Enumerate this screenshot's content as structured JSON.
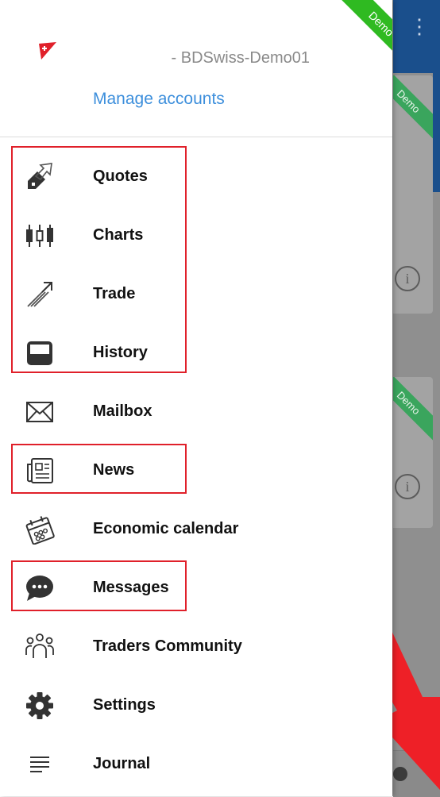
{
  "app": {
    "demo_badge": "Demo",
    "brand_color": "#e0202a",
    "accent": "#3d8fdc"
  },
  "account": {
    "name": "- BDSwiss-Demo01",
    "manage_label": "Manage accounts"
  },
  "menu": [
    {
      "label": "Quotes",
      "icon": "quotes-icon"
    },
    {
      "label": "Charts",
      "icon": "candlestick-icon"
    },
    {
      "label": "Trade",
      "icon": "trade-icon"
    },
    {
      "label": "History",
      "icon": "inbox-tray-icon"
    },
    {
      "label": "Mailbox",
      "icon": "envelope-icon"
    },
    {
      "label": "News",
      "icon": "newspaper-icon"
    },
    {
      "label": "Economic calendar",
      "icon": "calendar-icon"
    },
    {
      "label": "Messages",
      "icon": "chat-bubble-icon"
    },
    {
      "label": "Traders Community",
      "icon": "community-icon"
    },
    {
      "label": "Settings",
      "icon": "gear-icon"
    },
    {
      "label": "Journal",
      "icon": "journal-lines-icon"
    }
  ],
  "background": {
    "card_badge": "Demo"
  }
}
